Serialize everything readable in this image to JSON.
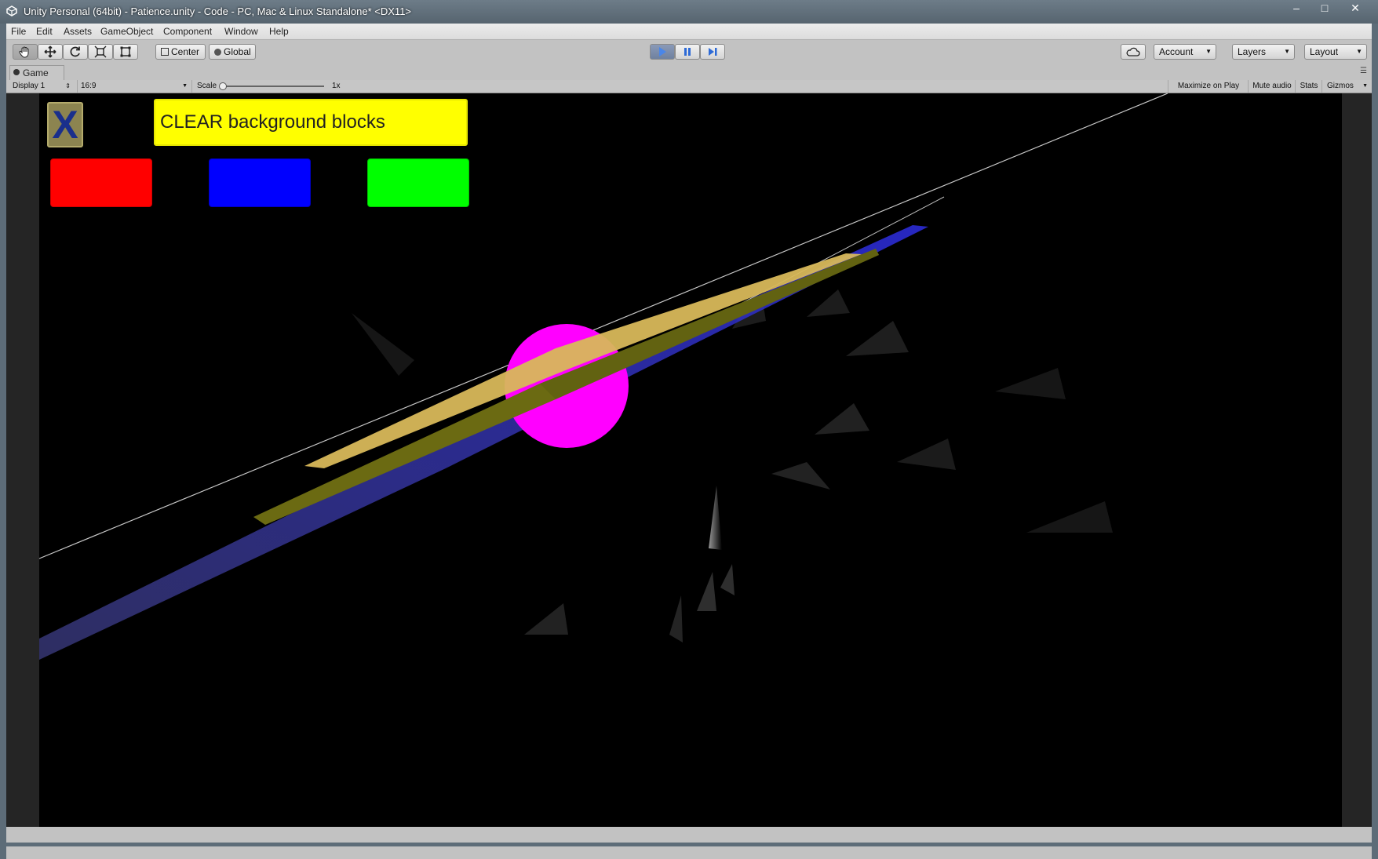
{
  "window": {
    "title": "Unity Personal (64bit) - Patience.unity - Code - PC, Mac & Linux Standalone* <DX11>",
    "minimize_glyph": "–",
    "maximize_glyph": "□",
    "close_glyph": "✕"
  },
  "menu": {
    "items": [
      "File",
      "Edit",
      "Assets",
      "GameObject",
      "Component",
      "Window",
      "Help"
    ]
  },
  "toolbar": {
    "tools": [
      "hand-icon",
      "move-icon",
      "rotate-icon",
      "scale-icon",
      "rect-icon"
    ],
    "active_tool": "hand-icon",
    "pivot_label": "Center",
    "space_label": "Global",
    "play_state": "playing",
    "account_label": "Account",
    "layers_label": "Layers",
    "layout_label": "Layout"
  },
  "game_view": {
    "tab_label": "Game",
    "display_label": "Display 1",
    "aspect_label": "16:9",
    "scale_label": "Scale",
    "scale_value": "1x",
    "scale_fraction": 0.0,
    "maximize_on_play": "Maximize on Play",
    "mute_audio": "Mute audio",
    "stats": "Stats",
    "gizmos": "Gizmos"
  },
  "game_ui": {
    "close_button_label": "X",
    "clear_button_label": "CLEAR background blocks",
    "color_buttons": [
      {
        "name": "red",
        "color": "#ff0000"
      },
      {
        "name": "blue",
        "color": "#0000ff"
      },
      {
        "name": "green",
        "color": "#00ff00"
      }
    ]
  },
  "colors": {
    "sphere": "#ff00ff",
    "ribbon_light": "#d8b85a",
    "ribbon_dark": "#6b6a12",
    "clear_button_bg": "#ffff00",
    "x_button_bg": "#8c8450",
    "x_glyph": "#1a2f8c",
    "play_active": "#4a86e8"
  }
}
